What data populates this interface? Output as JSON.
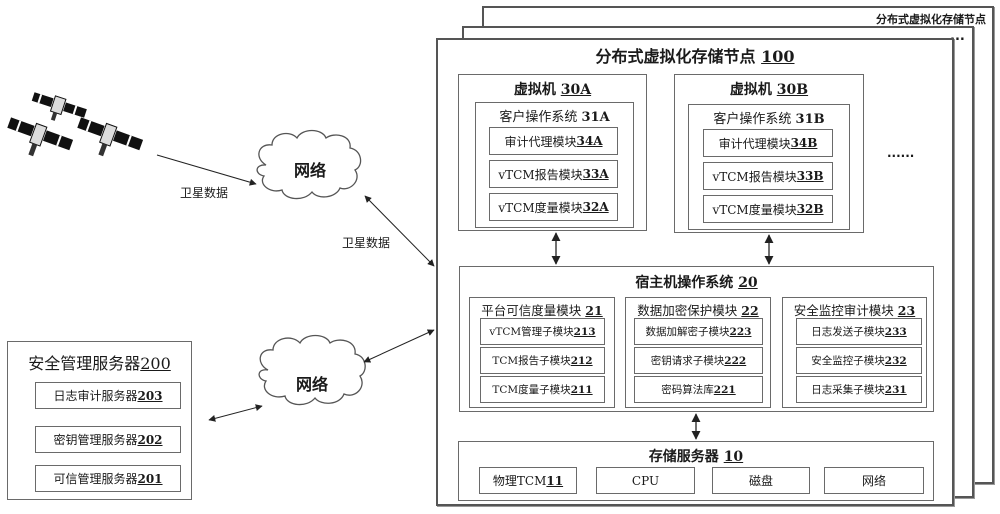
{
  "storage_node_stack": {
    "back_title": "分布式虚拟化存储节点",
    "more_nodes_ellipsis": "...",
    "title": "分布式虚拟化存储节点",
    "title_num": "100"
  },
  "vm_a": {
    "title": "虚拟机",
    "num": "30A",
    "guest_os": "客户操作系统",
    "guest_os_num": "31A",
    "modules": [
      {
        "label": "审计代理模块",
        "num": "34A"
      },
      {
        "label": "vTCM报告模块 ",
        "num": "33A"
      },
      {
        "label": "vTCM度量模块 ",
        "num": "32A"
      }
    ]
  },
  "vm_b": {
    "title": "虚拟机",
    "num": "30B",
    "guest_os": "客户操作系统",
    "guest_os_num": "31B",
    "modules": [
      {
        "label": "审计代理模块",
        "num": "34B"
      },
      {
        "label": "vTCM报告模块 ",
        "num": "33B"
      },
      {
        "label": "vTCM度量模块 ",
        "num": "32B"
      }
    ]
  },
  "more_vms_ellipsis": "......",
  "host_os": {
    "title": "宿主机操作系统",
    "num": "20",
    "groups": [
      {
        "title": "平台可信度量模块",
        "num": "21",
        "items": [
          {
            "label": "vTCM管理子模块 ",
            "num": "213"
          },
          {
            "label": "TCM报告子模块 ",
            "num": "212"
          },
          {
            "label": "TCM度量子模块 ",
            "num": "211"
          }
        ]
      },
      {
        "title": "数据加密保护模块",
        "num": "22",
        "items": [
          {
            "label": "数据加解密子模块 ",
            "num": "223"
          },
          {
            "label": "密钥请求子模块 ",
            "num": "222"
          },
          {
            "label": "密码算法库",
            "num": "221"
          }
        ]
      },
      {
        "title": "安全监控审计模块",
        "num": "23",
        "items": [
          {
            "label": "日志发送子模块 ",
            "num": "233"
          },
          {
            "label": "安全监控子模块 ",
            "num": "232"
          },
          {
            "label": "日志采集子模块 ",
            "num": "231"
          }
        ]
      }
    ]
  },
  "storage_server": {
    "title": "存储服务器",
    "num": "10",
    "components": [
      {
        "label": "物理TCM ",
        "num": "11"
      },
      {
        "label": "CPU",
        "num": ""
      },
      {
        "label": "磁盘",
        "num": ""
      },
      {
        "label": "网络",
        "num": ""
      }
    ]
  },
  "security_server": {
    "title": "安全管理服务器",
    "num": "200",
    "items": [
      {
        "label": "日志审计服务器 ",
        "num": "203"
      },
      {
        "label": "密钥管理服务器 ",
        "num": "202"
      },
      {
        "label": "可信管理服务器 ",
        "num": "201"
      }
    ]
  },
  "network_top": {
    "label": "网络"
  },
  "network_bottom": {
    "label": "网络"
  },
  "edge_labels": {
    "satellite_to_network": "卫星数据",
    "network_to_node": "卫星数据"
  },
  "colors": {
    "border": "#6a6a6a",
    "arrow": "#222222",
    "satellite": "#111111"
  }
}
